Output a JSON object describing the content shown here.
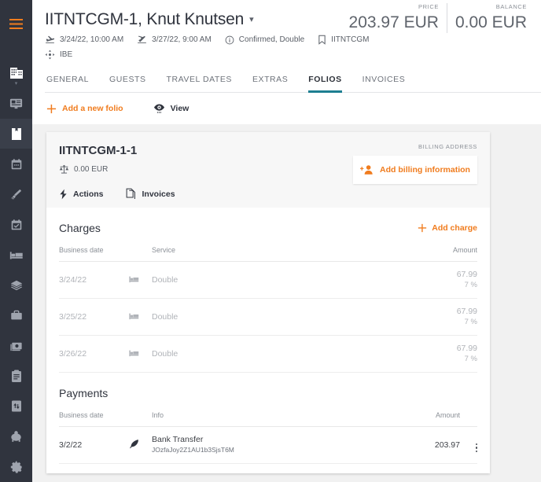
{
  "sidebar": {
    "items": [
      {
        "name": "menu-hamburger",
        "icon": "hamburger-icon",
        "active": false
      },
      {
        "name": "property",
        "icon": "building-icon",
        "active": false
      },
      {
        "name": "dashboard",
        "icon": "monitor-icon",
        "active": false
      },
      {
        "name": "reservations",
        "icon": "book-icon",
        "active": true
      },
      {
        "name": "calendar",
        "icon": "calendar-icon",
        "active": false
      },
      {
        "name": "housekeeping",
        "icon": "broom-icon",
        "active": false
      },
      {
        "name": "tasks",
        "icon": "calendar-check-icon",
        "active": false
      },
      {
        "name": "rooms",
        "icon": "bed-icon",
        "active": false
      },
      {
        "name": "inventory",
        "icon": "layers-icon",
        "active": false
      },
      {
        "name": "services",
        "icon": "briefcase-icon",
        "active": false
      },
      {
        "name": "cashier",
        "icon": "cash-icon",
        "active": false
      },
      {
        "name": "reports",
        "icon": "clipboard-icon",
        "active": false
      },
      {
        "name": "transfers",
        "icon": "transfer-icon",
        "active": false
      },
      {
        "name": "accounting",
        "icon": "piggy-bank-icon",
        "active": false
      },
      {
        "name": "settings",
        "icon": "gear-icon",
        "active": false
      }
    ]
  },
  "header": {
    "title": "IITNTCGM-1, Knut Knutsen",
    "dropdown_caret": "▾",
    "totals": [
      {
        "label": "PRICE",
        "value": "203.97 EUR"
      },
      {
        "label": "BALANCE",
        "value": "0.00 EUR"
      }
    ],
    "meta": [
      {
        "icon": "plane-arrival-icon",
        "text": "3/24/22, 10:00 AM"
      },
      {
        "icon": "plane-departure-icon",
        "text": "3/27/22, 9:00 AM"
      },
      {
        "icon": "info-circle-icon",
        "text": "Confirmed, Double"
      },
      {
        "icon": "bookmark-icon",
        "text": "IITNTCGM"
      }
    ],
    "meta_second": [
      {
        "icon": "move-arrows-icon",
        "text": "IBE"
      }
    ],
    "tabs": [
      {
        "label": "GENERAL",
        "active": false
      },
      {
        "label": "GUESTS",
        "active": false
      },
      {
        "label": "TRAVEL DATES",
        "active": false
      },
      {
        "label": "EXTRAS",
        "active": false
      },
      {
        "label": "FOLIOS",
        "active": true
      },
      {
        "label": "INVOICES",
        "active": false
      }
    ]
  },
  "actionbar": {
    "add_folio": "Add a new folio",
    "view": "View"
  },
  "folio": {
    "code": "IITNTCGM-1-1",
    "balance": "0.00 EUR",
    "actions_label": "Actions",
    "invoices_label": "Invoices",
    "billing_label": "BILLING ADDRESS",
    "billing_button": "Add billing information",
    "charges": {
      "title": "Charges",
      "add_label": "Add charge",
      "columns": [
        "Business date",
        "Service",
        "Amount"
      ],
      "rows": [
        {
          "date": "3/24/22",
          "icon": "bed-icon",
          "service": "Double",
          "amount": "67.99",
          "tax": "7 %"
        },
        {
          "date": "3/25/22",
          "icon": "bed-icon",
          "service": "Double",
          "amount": "67.99",
          "tax": "7 %"
        },
        {
          "date": "3/26/22",
          "icon": "bed-icon",
          "service": "Double",
          "amount": "67.99",
          "tax": "7 %"
        }
      ]
    },
    "payments": {
      "title": "Payments",
      "columns": [
        "Business date",
        "Info",
        "Amount"
      ],
      "rows": [
        {
          "date": "3/2/22",
          "icon": "feather-icon",
          "info_main": "Bank Transfer",
          "info_sub": "JOzfaJoy2Z1AU1b3SjsT6M",
          "amount": "203.97",
          "menu": "kebab-menu-icon"
        }
      ]
    }
  },
  "colors": {
    "accent_orange": "#f07c1e",
    "sidebar_bg": "#30343e",
    "tab_active_underline": "#1d7e91",
    "page_bg": "#f1f1f1"
  }
}
